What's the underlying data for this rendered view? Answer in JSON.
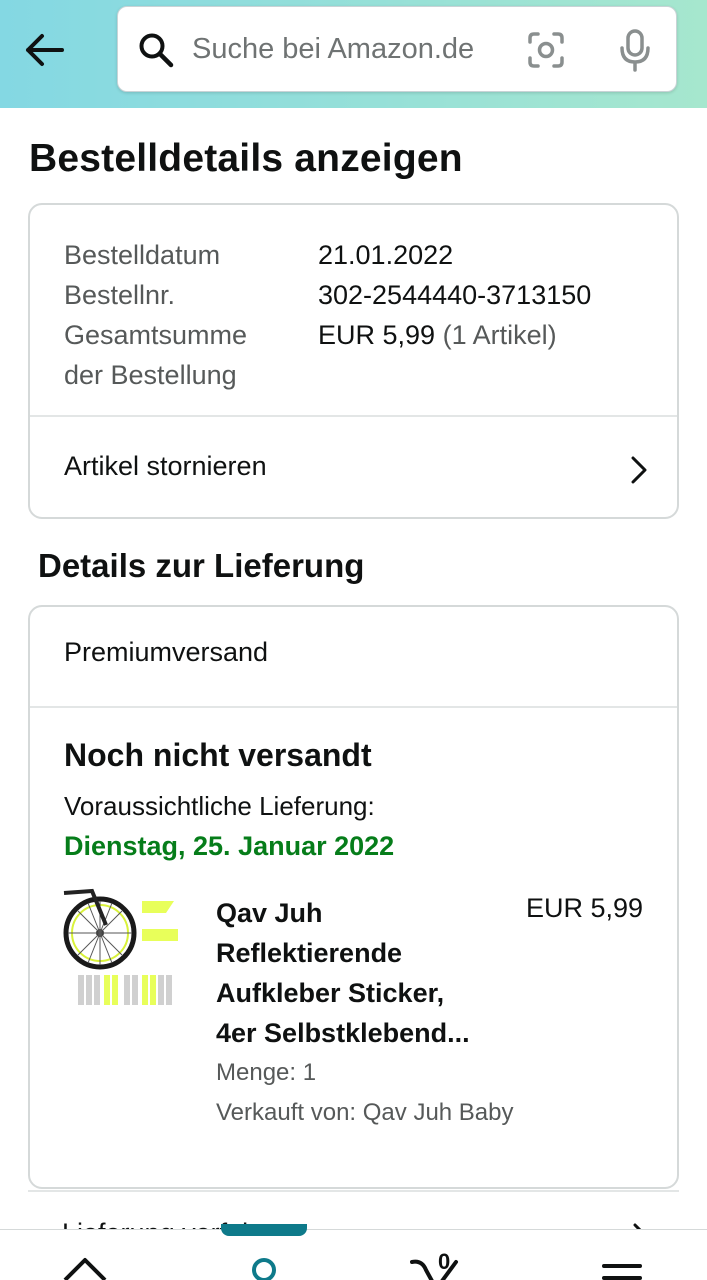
{
  "header": {
    "search_placeholder": "Suche bei Amazon.de",
    "gradient_start": "#84d8e3",
    "gradient_end": "#a6e7ce",
    "icons": [
      "back-arrow-icon",
      "search-icon",
      "camera-icon",
      "mic-icon"
    ]
  },
  "page": {
    "title": "Bestelldetails anzeigen"
  },
  "order": {
    "date_label": "Bestelldatum",
    "date_value": "21.01.2022",
    "number_label": "Bestellnr.",
    "number_value": "302-2544440-3713150",
    "total_label_1": "Gesamtsumme",
    "total_label_2": "der Bestellung",
    "total_value": "EUR 5,99",
    "total_items": "(1 Artikel)",
    "cancel_label": "Artikel stornieren"
  },
  "delivery": {
    "section_title": "Details zur Lieferung",
    "shipping_method": "Premiumversand",
    "status": "Noch nicht versandt",
    "expected_label": "Voraussichtliche Lieferung:",
    "expected_date": "Dienstag, 25. Januar 2022",
    "expected_date_color": "#067d1a",
    "product": {
      "title_lines": [
        "Qav Juh",
        "Reflektierende",
        "Aufkleber Sticker,",
        "4er Selbstklebend..."
      ],
      "price": "EUR 5,99",
      "quantity": "Menge: 1",
      "seller": "Verkauft von: Qav Juh Baby"
    }
  },
  "next_row": {
    "label": "Lieferung verfolgen"
  },
  "bottom_nav": {
    "cart_count": "0",
    "active_color": "#0e7a8a",
    "icons": [
      "home-icon",
      "account-icon",
      "cart-icon",
      "menu-icon"
    ]
  }
}
